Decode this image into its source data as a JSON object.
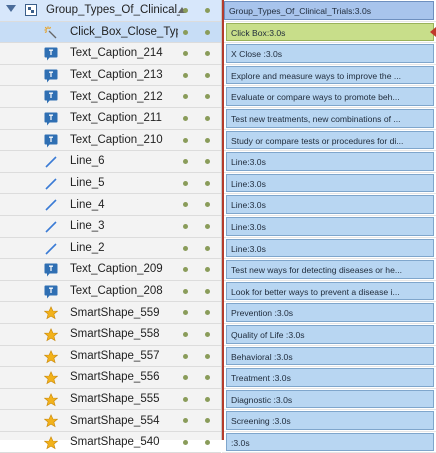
{
  "layers": [
    {
      "name": "Group_Types_Of_Clinical_",
      "icon": "group-icon",
      "kind": "group"
    },
    {
      "name": "Click_Box_Close_Types_",
      "icon": "click-box-icon",
      "kind": "child",
      "selected": true
    },
    {
      "name": "Text_Caption_214",
      "icon": "text-caption-icon",
      "kind": "child"
    },
    {
      "name": "Text_Caption_213",
      "icon": "text-caption-icon",
      "kind": "child"
    },
    {
      "name": "Text_Caption_212",
      "icon": "text-caption-icon",
      "kind": "child"
    },
    {
      "name": "Text_Caption_211",
      "icon": "text-caption-icon",
      "kind": "child"
    },
    {
      "name": "Text_Caption_210",
      "icon": "text-caption-icon",
      "kind": "child"
    },
    {
      "name": "Line_6",
      "icon": "line-icon",
      "kind": "child"
    },
    {
      "name": "Line_5",
      "icon": "line-icon",
      "kind": "child"
    },
    {
      "name": "Line_4",
      "icon": "line-icon",
      "kind": "child"
    },
    {
      "name": "Line_3",
      "icon": "line-icon",
      "kind": "child"
    },
    {
      "name": "Line_2",
      "icon": "line-icon",
      "kind": "child"
    },
    {
      "name": "Text_Caption_209",
      "icon": "text-caption-icon",
      "kind": "child"
    },
    {
      "name": "Text_Caption_208",
      "icon": "text-caption-icon",
      "kind": "child"
    },
    {
      "name": "SmartShape_559",
      "icon": "star-icon",
      "kind": "child"
    },
    {
      "name": "SmartShape_558",
      "icon": "star-icon",
      "kind": "child"
    },
    {
      "name": "SmartShape_557",
      "icon": "star-icon",
      "kind": "child"
    },
    {
      "name": "SmartShape_556",
      "icon": "star-icon",
      "kind": "child"
    },
    {
      "name": "SmartShape_555",
      "icon": "star-icon",
      "kind": "child"
    },
    {
      "name": "SmartShape_554",
      "icon": "star-icon",
      "kind": "child"
    },
    {
      "name": "SmartShape_540",
      "icon": "star-icon",
      "kind": "child"
    }
  ],
  "tracks": [
    {
      "label": "Group_Types_Of_Clinical_Trials:3.0s",
      "kind": "group"
    },
    {
      "label": "Click Box:3.0s",
      "kind": "click"
    },
    {
      "label": "X Close  :3.0s",
      "kind": "normal"
    },
    {
      "label": "Explore and measure ways to improve the ...",
      "kind": "normal"
    },
    {
      "label": "Evaluate or compare ways to promote beh...",
      "kind": "normal"
    },
    {
      "label": "Test new treatments, new combinations of ...",
      "kind": "normal"
    },
    {
      "label": "Study or compare tests or procedures for di...",
      "kind": "normal"
    },
    {
      "label": "Line:3.0s",
      "kind": "normal"
    },
    {
      "label": "Line:3.0s",
      "kind": "normal"
    },
    {
      "label": "Line:3.0s",
      "kind": "normal"
    },
    {
      "label": "Line:3.0s",
      "kind": "normal"
    },
    {
      "label": "Line:3.0s",
      "kind": "normal"
    },
    {
      "label": "Test new ways for detecting diseases or he...",
      "kind": "normal"
    },
    {
      "label": "Look for better ways to prevent a disease i...",
      "kind": "normal"
    },
    {
      "label": "Prevention :3.0s",
      "kind": "normal"
    },
    {
      "label": "Quality of Life :3.0s",
      "kind": "normal"
    },
    {
      "label": "Behavioral :3.0s",
      "kind": "normal"
    },
    {
      "label": "Treatment :3.0s",
      "kind": "normal"
    },
    {
      "label": "Diagnostic  :3.0s",
      "kind": "normal"
    },
    {
      "label": "Screening :3.0s",
      "kind": "normal"
    },
    {
      "label": " :3.0s",
      "kind": "normal"
    }
  ],
  "colors": {
    "accent": "#c0392b",
    "bar": "#b8d6f2",
    "click_bar": "#c8de8a"
  }
}
